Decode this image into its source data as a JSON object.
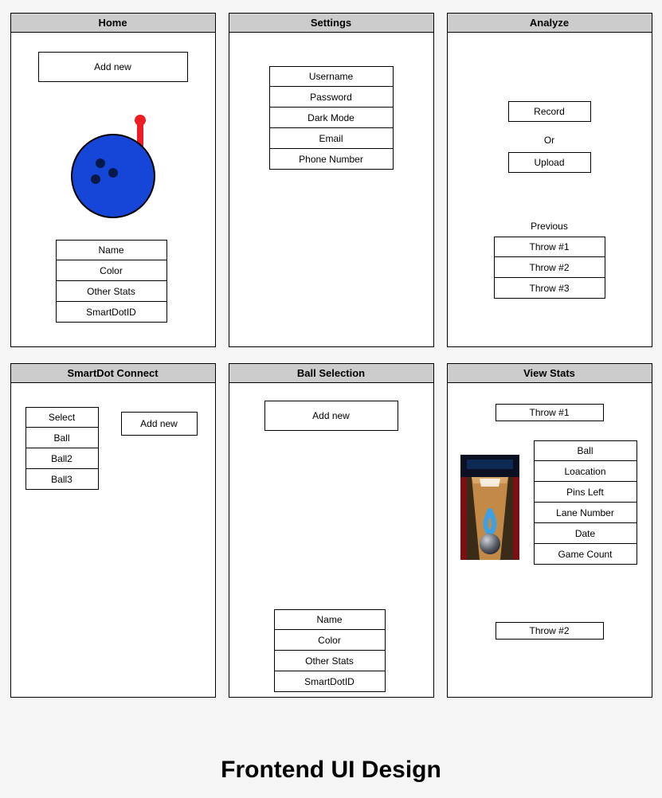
{
  "footer_title": "Frontend UI Design",
  "panels": {
    "home": {
      "title": "Home",
      "add_new": "Add new",
      "stats": [
        "Name",
        "Color",
        "Other Stats",
        "SmartDotID"
      ]
    },
    "settings": {
      "title": "Settings",
      "fields": [
        "Username",
        "Password",
        "Dark Mode",
        "Email",
        "Phone Number"
      ]
    },
    "analyze": {
      "title": "Analyze",
      "record": "Record",
      "or": "Or",
      "upload": "Upload",
      "previous_label": "Previous",
      "throws": [
        "Throw #1",
        "Throw #2",
        "Throw #3"
      ]
    },
    "smartdot": {
      "title": "SmartDot Connect",
      "add_new": "Add new",
      "list": [
        "Select",
        "Ball",
        "Ball2",
        "Ball3"
      ]
    },
    "ball_selection": {
      "title": "Ball Selection",
      "add_new": "Add new",
      "stats": [
        "Name",
        "Color",
        "Other Stats",
        "SmartDotID"
      ]
    },
    "view_stats": {
      "title": "View Stats",
      "throw1": "Throw #1",
      "throw2": "Throw #2",
      "fields": [
        "Ball",
        "Loacation",
        "Pins Left",
        "Lane Number",
        "Date",
        "Game Count"
      ]
    }
  }
}
